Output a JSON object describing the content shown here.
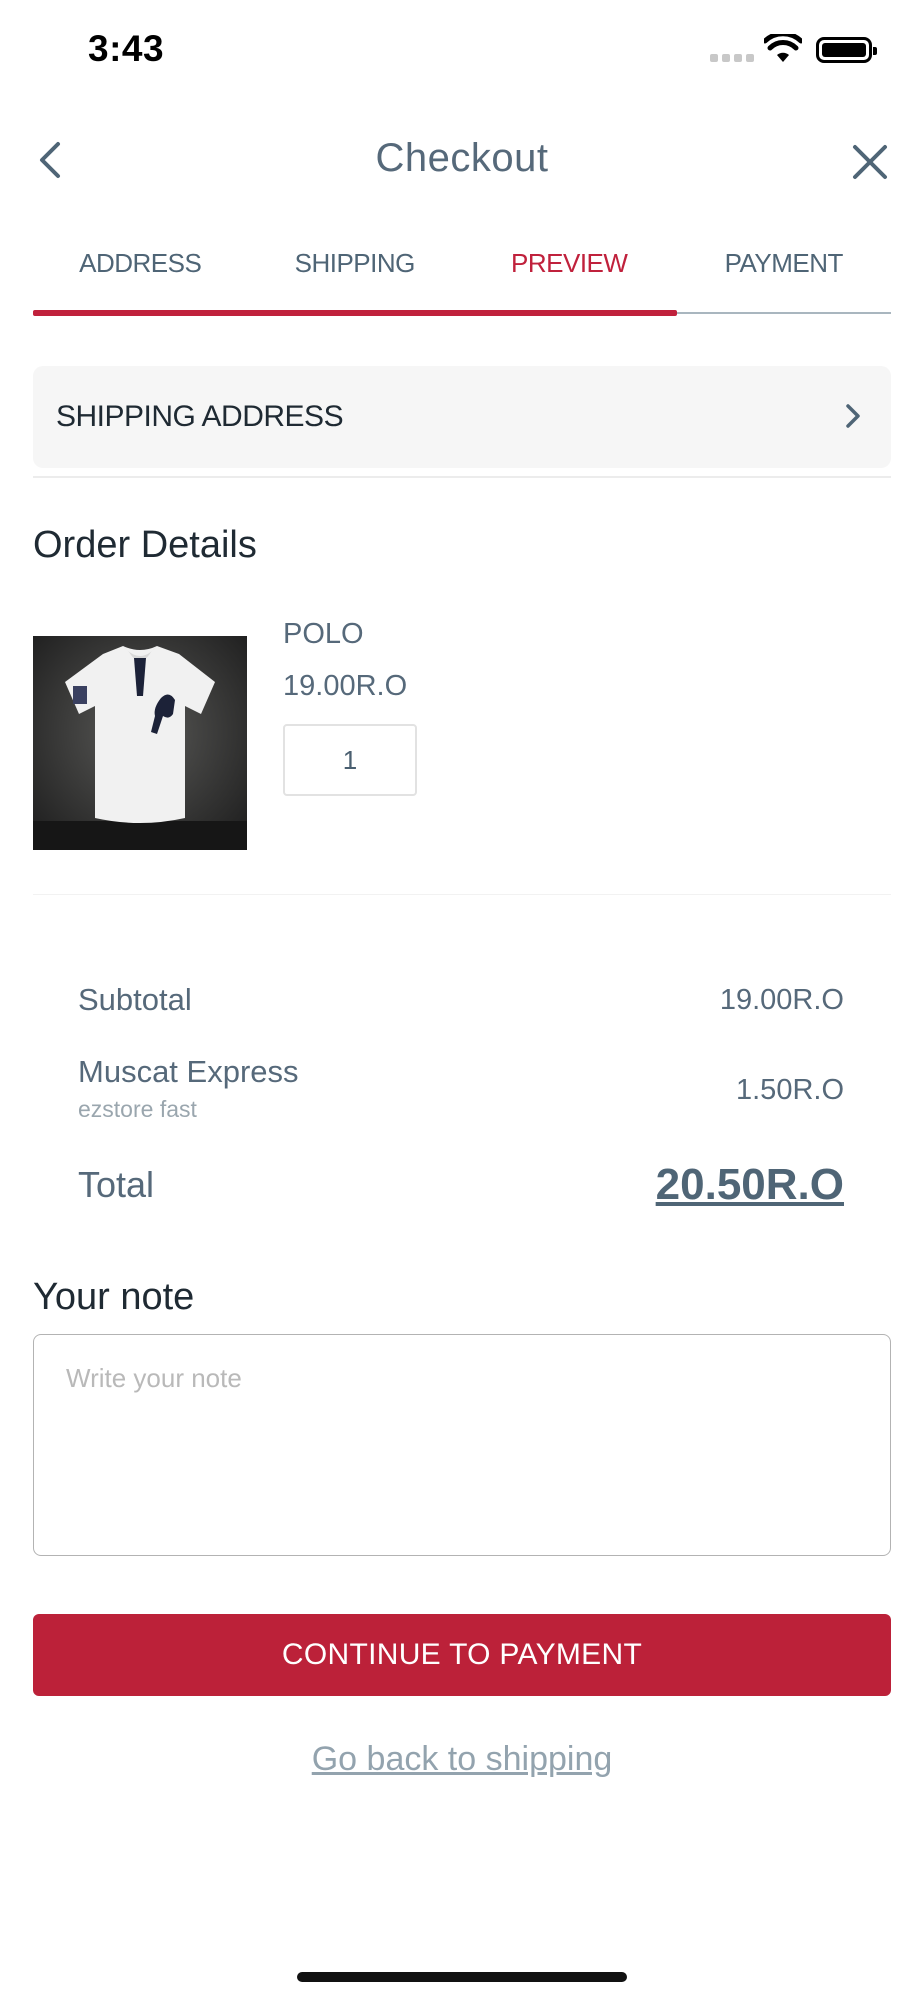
{
  "status_bar": {
    "time": "3:43"
  },
  "nav": {
    "title": "Checkout",
    "back_icon": "chevron-left-icon",
    "close_icon": "close-icon"
  },
  "tabs": [
    {
      "label": "ADDRESS"
    },
    {
      "label": "SHIPPING"
    },
    {
      "label": "PREVIEW",
      "active": true
    },
    {
      "label": "PAYMENT"
    }
  ],
  "progress": {
    "completed_steps": 3,
    "total_steps": 4
  },
  "shipping_address": {
    "label": "SHIPPING ADDRESS"
  },
  "order_details": {
    "title": "Order Details",
    "items": [
      {
        "name": "POLO",
        "price": "19.00R.O",
        "quantity": "1"
      }
    ]
  },
  "summary": {
    "subtotal_label": "Subtotal",
    "subtotal_value": "19.00R.O",
    "shipping_method": "Muscat Express",
    "shipping_sub": "ezstore fast",
    "shipping_value": "1.50R.O",
    "total_label": "Total",
    "total_value": "20.50R.O"
  },
  "note": {
    "title": "Your note",
    "placeholder": "Write your note"
  },
  "actions": {
    "continue_label": "CONTINUE TO PAYMENT",
    "back_label": "Go back to shipping"
  },
  "colors": {
    "accent": "#bc2139",
    "text": "#56697a"
  }
}
